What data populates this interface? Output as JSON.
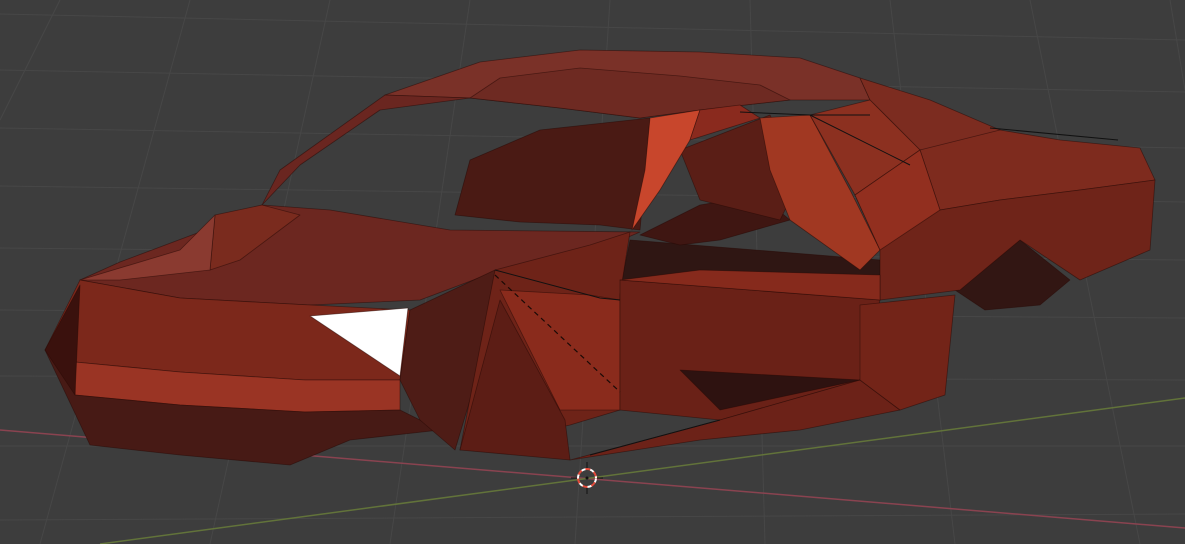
{
  "viewport": {
    "background": "#3d3d3d",
    "grid_color": "#474747",
    "x_axis_color": "#8a4350",
    "y_axis_color": "#62733a"
  },
  "object": {
    "type": "low-poly car body mesh",
    "material_color": "#8a2a1a",
    "selected_face_color": "#ffffff"
  },
  "cursor_3d": {
    "icon": "3d-cursor-icon",
    "ring_colors": [
      "#e24a3a",
      "#ffffff"
    ]
  }
}
